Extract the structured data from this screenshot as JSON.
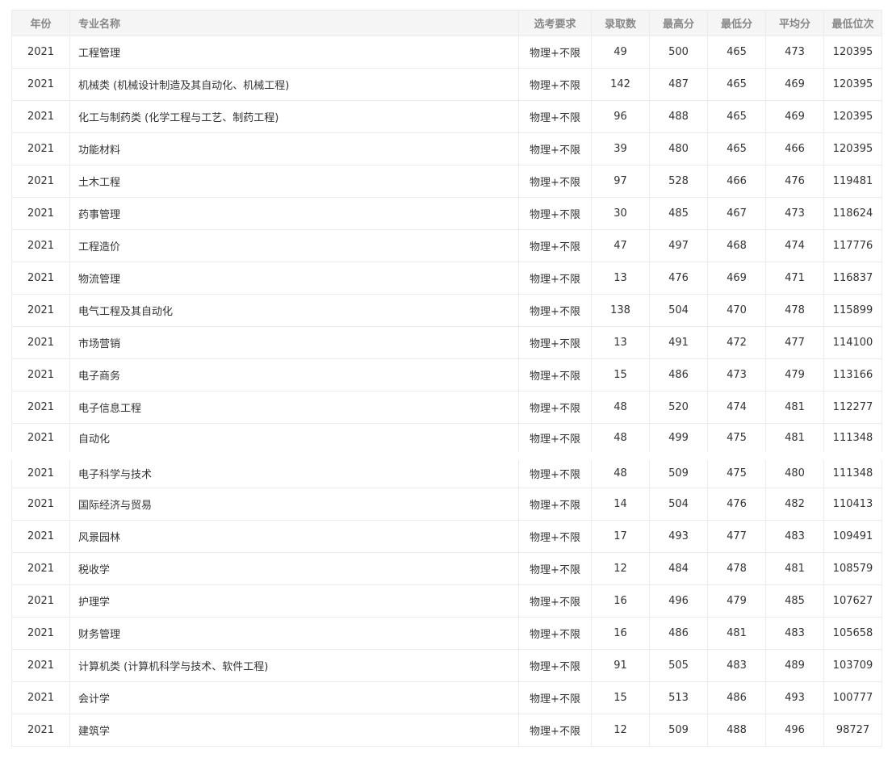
{
  "headers": {
    "year": "年份",
    "name": "专业名称",
    "requirement": "选考要求",
    "admitted": "录取数",
    "max": "最高分",
    "min": "最低分",
    "avg": "平均分",
    "min_rank": "最低位次"
  },
  "rows": [
    {
      "year": "2021",
      "name": "工程管理",
      "requirement": "物理+不限",
      "admitted": "49",
      "max": "500",
      "min": "465",
      "avg": "473",
      "min_rank": "120395"
    },
    {
      "year": "2021",
      "name": "机械类 (机械设计制造及其自动化、机械工程)",
      "requirement": "物理+不限",
      "admitted": "142",
      "max": "487",
      "min": "465",
      "avg": "469",
      "min_rank": "120395"
    },
    {
      "year": "2021",
      "name": "化工与制药类 (化学工程与工艺、制药工程)",
      "requirement": "物理+不限",
      "admitted": "96",
      "max": "488",
      "min": "465",
      "avg": "469",
      "min_rank": "120395"
    },
    {
      "year": "2021",
      "name": "功能材料",
      "requirement": "物理+不限",
      "admitted": "39",
      "max": "480",
      "min": "465",
      "avg": "466",
      "min_rank": "120395"
    },
    {
      "year": "2021",
      "name": "土木工程",
      "requirement": "物理+不限",
      "admitted": "97",
      "max": "528",
      "min": "466",
      "avg": "476",
      "min_rank": "119481"
    },
    {
      "year": "2021",
      "name": "药事管理",
      "requirement": "物理+不限",
      "admitted": "30",
      "max": "485",
      "min": "467",
      "avg": "473",
      "min_rank": "118624"
    },
    {
      "year": "2021",
      "name": "工程造价",
      "requirement": "物理+不限",
      "admitted": "47",
      "max": "497",
      "min": "468",
      "avg": "474",
      "min_rank": "117776"
    },
    {
      "year": "2021",
      "name": "物流管理",
      "requirement": "物理+不限",
      "admitted": "13",
      "max": "476",
      "min": "469",
      "avg": "471",
      "min_rank": "116837"
    },
    {
      "year": "2021",
      "name": "电气工程及其自动化",
      "requirement": "物理+不限",
      "admitted": "138",
      "max": "504",
      "min": "470",
      "avg": "478",
      "min_rank": "115899"
    },
    {
      "year": "2021",
      "name": "市场营销",
      "requirement": "物理+不限",
      "admitted": "13",
      "max": "491",
      "min": "472",
      "avg": "477",
      "min_rank": "114100"
    },
    {
      "year": "2021",
      "name": "电子商务",
      "requirement": "物理+不限",
      "admitted": "15",
      "max": "486",
      "min": "473",
      "avg": "479",
      "min_rank": "113166"
    },
    {
      "year": "2021",
      "name": "电子信息工程",
      "requirement": "物理+不限",
      "admitted": "48",
      "max": "520",
      "min": "474",
      "avg": "481",
      "min_rank": "112277"
    },
    {
      "year": "2021",
      "name": "自动化",
      "requirement": "物理+不限",
      "admitted": "48",
      "max": "499",
      "min": "475",
      "avg": "481",
      "min_rank": "111348"
    },
    {
      "year": "2021",
      "name": "电子科学与技术",
      "requirement": "物理+不限",
      "admitted": "48",
      "max": "509",
      "min": "475",
      "avg": "480",
      "min_rank": "111348"
    },
    {
      "year": "2021",
      "name": "国际经济与贸易",
      "requirement": "物理+不限",
      "admitted": "14",
      "max": "504",
      "min": "476",
      "avg": "482",
      "min_rank": "110413"
    },
    {
      "year": "2021",
      "name": "风景园林",
      "requirement": "物理+不限",
      "admitted": "17",
      "max": "493",
      "min": "477",
      "avg": "483",
      "min_rank": "109491"
    },
    {
      "year": "2021",
      "name": "税收学",
      "requirement": "物理+不限",
      "admitted": "12",
      "max": "484",
      "min": "478",
      "avg": "481",
      "min_rank": "108579"
    },
    {
      "year": "2021",
      "name": "护理学",
      "requirement": "物理+不限",
      "admitted": "16",
      "max": "496",
      "min": "479",
      "avg": "485",
      "min_rank": "107627"
    },
    {
      "year": "2021",
      "name": "财务管理",
      "requirement": "物理+不限",
      "admitted": "16",
      "max": "486",
      "min": "481",
      "avg": "483",
      "min_rank": "105658"
    },
    {
      "year": "2021",
      "name": "计算机类 (计算机科学与技术、软件工程)",
      "requirement": "物理+不限",
      "admitted": "91",
      "max": "505",
      "min": "483",
      "avg": "489",
      "min_rank": "103709"
    },
    {
      "year": "2021",
      "name": "会计学",
      "requirement": "物理+不限",
      "admitted": "15",
      "max": "513",
      "min": "486",
      "avg": "493",
      "min_rank": "100777"
    },
    {
      "year": "2021",
      "name": "建筑学",
      "requirement": "物理+不限",
      "admitted": "12",
      "max": "509",
      "min": "488",
      "avg": "496",
      "min_rank": "98727"
    }
  ]
}
